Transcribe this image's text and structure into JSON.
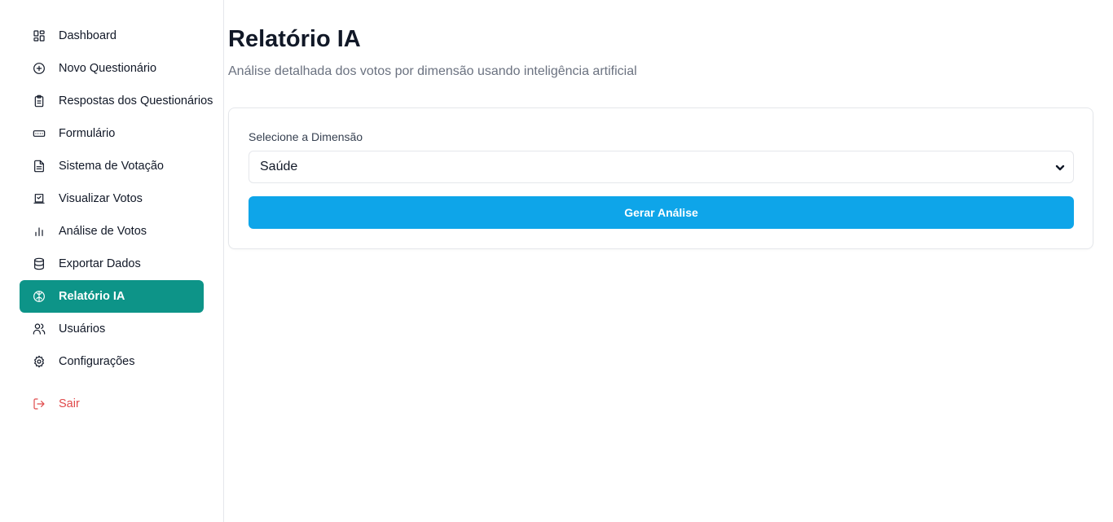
{
  "sidebar": {
    "items": [
      {
        "label": "Dashboard",
        "icon": "dashboard-icon"
      },
      {
        "label": "Novo Questionário",
        "icon": "plus-circle-icon"
      },
      {
        "label": "Respostas dos Questionários",
        "icon": "clipboard-icon"
      },
      {
        "label": "Formulário",
        "icon": "form-icon"
      },
      {
        "label": "Sistema de Votação",
        "icon": "file-text-icon"
      },
      {
        "label": "Visualizar Votos",
        "icon": "vote-icon"
      },
      {
        "label": "Análise de Votos",
        "icon": "bar-chart-icon"
      },
      {
        "label": "Exportar Dados",
        "icon": "database-icon"
      },
      {
        "label": "Relatório IA",
        "icon": "brain-icon",
        "active": true
      },
      {
        "label": "Usuários",
        "icon": "users-icon"
      },
      {
        "label": "Configurações",
        "icon": "gear-icon"
      }
    ],
    "logout": {
      "label": "Sair",
      "icon": "logout-icon"
    }
  },
  "page": {
    "title": "Relatório IA",
    "subtitle": "Análise detalhada dos votos por dimensão usando inteligência artificial"
  },
  "form": {
    "dimension_label": "Selecione a Dimensão",
    "dimension_value": "Saúde",
    "submit_label": "Gerar Análise"
  },
  "colors": {
    "accent": "#0d9488",
    "primary_button": "#0ea5e9",
    "logout": "#e0494a"
  }
}
